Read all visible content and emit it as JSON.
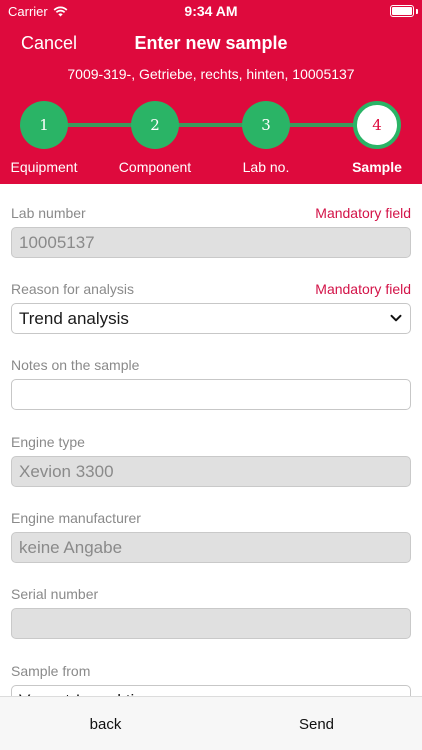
{
  "status": {
    "carrier": "Carrier",
    "time": "9:34 AM"
  },
  "nav": {
    "cancel_label": "Cancel",
    "title": "Enter new sample"
  },
  "subtitle": "7009-319-, Getriebe, rechts, hinten, 10005137",
  "steps": [
    {
      "number": "1",
      "label": "Equipment"
    },
    {
      "number": "2",
      "label": "Component"
    },
    {
      "number": "3",
      "label": "Lab no."
    },
    {
      "number": "4",
      "label": "Sample"
    }
  ],
  "form": {
    "mandatory_text": "Mandatory field",
    "fields": [
      {
        "label": "Lab number",
        "value": "10005137"
      },
      {
        "label": "Reason for analysis",
        "value": "Trend analysis"
      },
      {
        "label": "Notes on the sample",
        "value": ""
      },
      {
        "label": "Engine type",
        "value": "Xevion 3300"
      },
      {
        "label": "Engine manufacturer",
        "value": "keine Angabe"
      },
      {
        "label": "Serial number",
        "value": ""
      },
      {
        "label": "Sample from",
        "value": "Vor-ort-Inspektion"
      }
    ]
  },
  "bottom": {
    "back_label": "back",
    "send_label": "Send"
  }
}
